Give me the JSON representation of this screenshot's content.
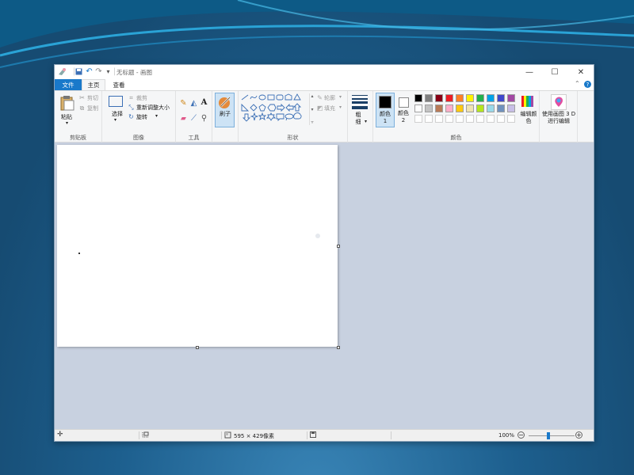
{
  "window": {
    "title": "无标题 - 画图",
    "colors": {
      "accent": "#1979ca",
      "ribbon_bg": "#f5f6f7",
      "workspace_bg": "#c8d1e0"
    }
  },
  "tabs": {
    "file": "文件",
    "home": "主页",
    "view": "查看"
  },
  "ribbon": {
    "clipboard": {
      "paste": "粘贴",
      "cut": "剪切",
      "copy": "复制",
      "label": "剪贴板"
    },
    "image": {
      "select": "选择",
      "crop": "裁剪",
      "resize": "重新调整大小",
      "rotate": "旋转",
      "label": "图像"
    },
    "tools": {
      "label": "工具"
    },
    "brushes": {
      "label": "刷子"
    },
    "shapes": {
      "outline": "轮廓",
      "fill": "填充",
      "label": "形状"
    },
    "size": {
      "label": "粗细"
    },
    "colors": {
      "color1": "颜色 1",
      "color2": "颜色 2",
      "edit": "编辑颜色",
      "label": "颜色",
      "color1_value": "#000000",
      "color2_value": "#ffffff",
      "palette_row1": [
        "#000000",
        "#7f7f7f",
        "#880015",
        "#ed1c24",
        "#ff7f27",
        "#fff200",
        "#22b14c",
        "#00a2e8",
        "#3f48cc",
        "#a349a4"
      ],
      "palette_row2": [
        "#ffffff",
        "#c3c3c3",
        "#b97a57",
        "#ffaec9",
        "#ffc90e",
        "#efe4b0",
        "#b5e61d",
        "#99d9ea",
        "#7092be",
        "#c8bfe7"
      ],
      "palette_row3": [
        "#ffffff",
        "#ffffff",
        "#ffffff",
        "#ffffff",
        "#ffffff",
        "#ffffff",
        "#ffffff",
        "#ffffff",
        "#ffffff",
        "#ffffff"
      ]
    },
    "paint3d": {
      "label": "使用画图 3 D 进行编辑"
    }
  },
  "status": {
    "canvas_size": "595 × 429像素",
    "zoom": "100%"
  }
}
